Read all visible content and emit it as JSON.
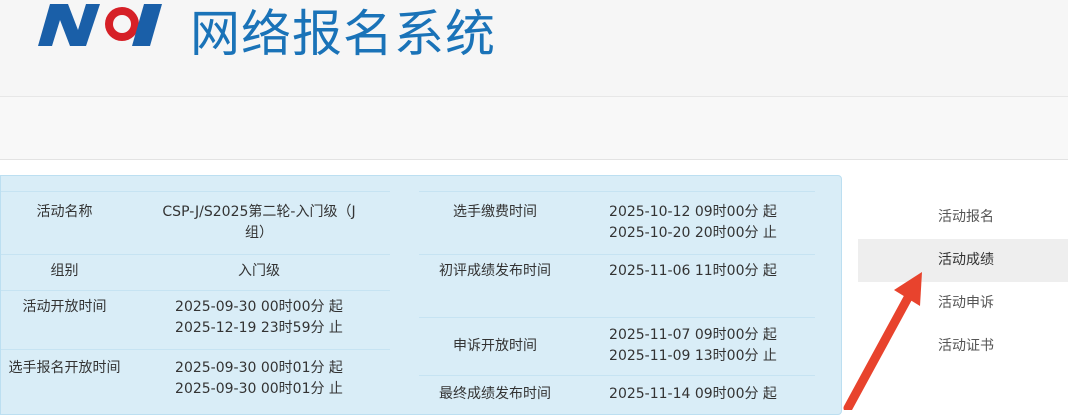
{
  "header": {
    "title": "网络报名系统"
  },
  "info_left": [
    {
      "label": "活动名称",
      "value": [
        "CSP-J/S2025第二轮-入门级（J",
        "组）"
      ]
    },
    {
      "label": "组别",
      "value": [
        "入门级"
      ]
    },
    {
      "label": "活动开放时间",
      "value": [
        "2025-09-30 00时00分 起",
        "2025-12-19 23时59分 止"
      ]
    },
    {
      "label": "选手报名开放时间",
      "value": [
        "2025-09-30 00时01分 起",
        "2025-09-30 00时01分 止"
      ]
    }
  ],
  "info_right": [
    {
      "label": "选手缴费时间",
      "value": [
        "2025-10-12 09时00分 起",
        "2025-10-20 20时00分 止"
      ]
    },
    {
      "label": "初评成绩发布时间",
      "value": [
        "2025-11-06 11时00分 起",
        ""
      ]
    },
    {
      "label": "申诉开放时间",
      "value": [
        "2025-11-07 09时00分 起",
        "2025-11-09 13时00分 止"
      ]
    },
    {
      "label": "最终成绩发布时间",
      "value": [
        "2025-11-14 09时00分 起"
      ]
    }
  ],
  "sidebar": {
    "items": [
      {
        "label": "活动报名",
        "active": false
      },
      {
        "label": "活动成绩",
        "active": true
      },
      {
        "label": "活动申诉",
        "active": false
      },
      {
        "label": "活动证书",
        "active": false
      }
    ]
  },
  "colors": {
    "title_blue": "#1a73b8",
    "panel_bg": "#d9edf7",
    "arrow_red": "#e8432d",
    "logo_red": "#d62027"
  }
}
